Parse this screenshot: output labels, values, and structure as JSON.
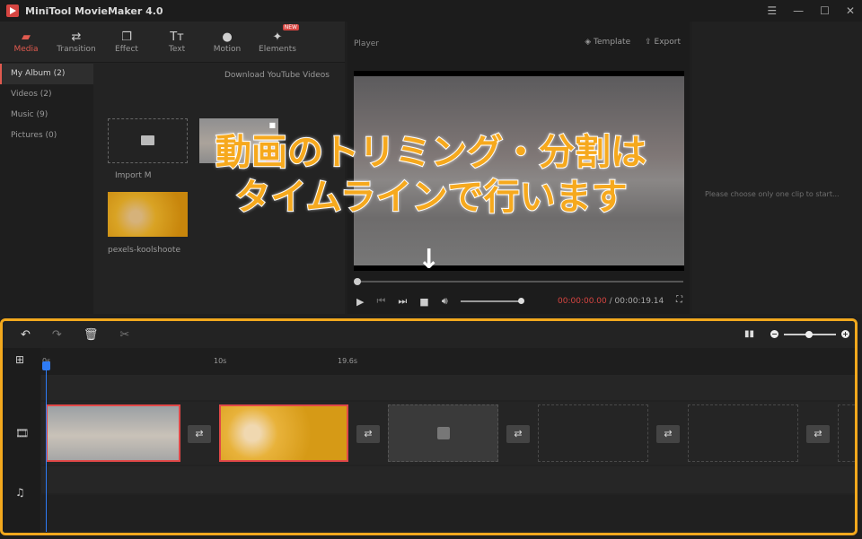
{
  "app": {
    "title": "MiniTool MovieMaker 4.0"
  },
  "window_controls": [
    "☰",
    "—",
    "☐",
    "✕"
  ],
  "tabs": [
    {
      "label": "Media",
      "icon": "folder-icon",
      "active": true
    },
    {
      "label": "Transition",
      "icon": "transition-icon"
    },
    {
      "label": "Effect",
      "icon": "effect-icon"
    },
    {
      "label": "Text",
      "icon": "text-icon"
    },
    {
      "label": "Motion",
      "icon": "motion-icon"
    },
    {
      "label": "Elements",
      "icon": "elements-icon",
      "badge": "NEW"
    }
  ],
  "album": {
    "items": [
      "My Album (2)",
      "Videos (2)",
      "Music (9)",
      "Pictures (0)"
    ],
    "download_link": "Download YouTube Videos",
    "import_label": "Import M",
    "thumb_name": "pexels-koolshoote"
  },
  "player": {
    "label": "Player",
    "template": "Template",
    "export": "Export",
    "time_current": "00:00:00.00",
    "time_total": "/ 00:00:19.14"
  },
  "properties": {
    "message": "Please choose only one clip to start..."
  },
  "overlay": {
    "line1": "動画のトリミング・分割は",
    "line2": "タイムラインで行います",
    "arrow": "↓"
  },
  "timeline": {
    "ticks": [
      "0s",
      "10s",
      "19.6s"
    ]
  },
  "colors": {
    "accent": "#e05a4f",
    "highlight": "#f2a81d",
    "playhead": "#2f7cf6"
  }
}
